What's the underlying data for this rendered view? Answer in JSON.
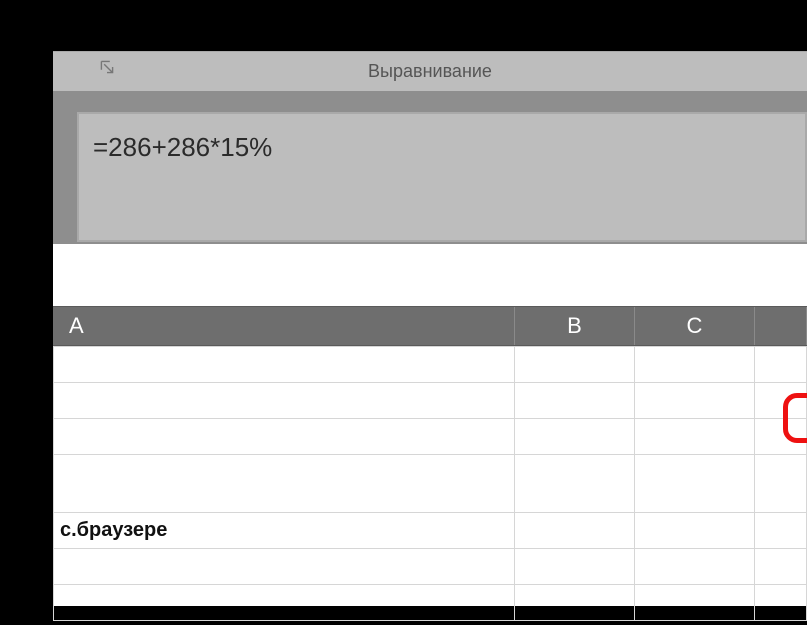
{
  "ribbon": {
    "group_label": "Выравнивание"
  },
  "formula_bar": {
    "value": "=286+286*15%"
  },
  "columns": {
    "a": "A",
    "b": "B",
    "c": "C",
    "d": ""
  },
  "cells": {
    "row1": {
      "a": "",
      "b": "",
      "c": "",
      "d": ""
    },
    "row2": {
      "a": "",
      "b": "",
      "c": "",
      "d": ""
    },
    "row3": {
      "a": "",
      "b": "",
      "c": "",
      "d": ""
    },
    "row4": {
      "a": "",
      "b": "",
      "c": "",
      "d": ""
    },
    "row5": {
      "a": "с.браузере",
      "b": "",
      "c": "",
      "d": ""
    },
    "row6": {
      "a": "",
      "b": "",
      "c": "",
      "d": ""
    },
    "row7": {
      "a": "",
      "b": "",
      "c": "",
      "d": ""
    }
  }
}
